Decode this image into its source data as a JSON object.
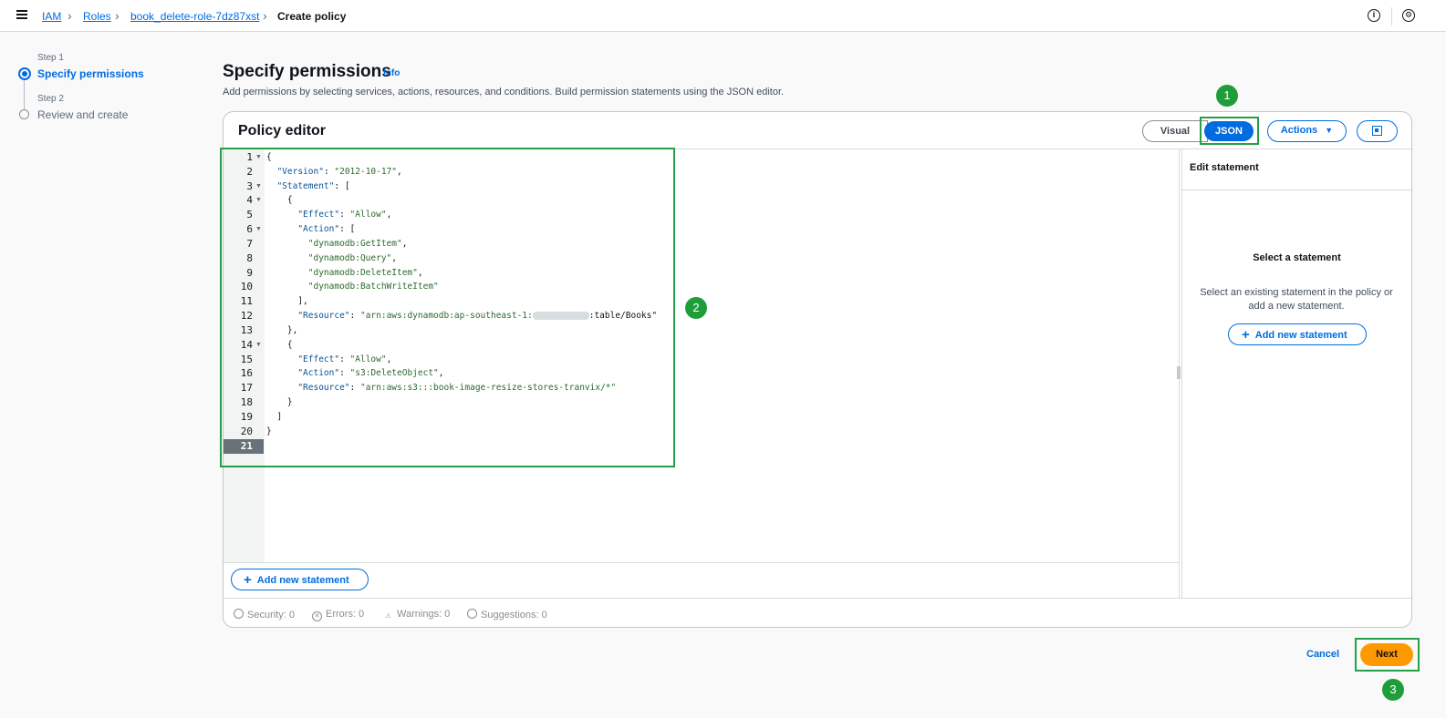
{
  "breadcrumbs": [
    "IAM",
    "Roles",
    "book_delete-role-7dz87xst",
    "Create policy"
  ],
  "steps": [
    {
      "step": "Step 1",
      "label": "Specify permissions"
    },
    {
      "step": "Step 2",
      "label": "Review and create"
    }
  ],
  "header": {
    "title": "Specify permissions",
    "info": "Info",
    "description": "Add permissions by selecting services, actions, resources, and conditions. Build permission statements using the JSON editor."
  },
  "editor": {
    "title": "Policy editor",
    "visual_label": "Visual",
    "json_label": "JSON",
    "actions_label": "Actions",
    "add_statement_label": "Add new statement"
  },
  "code_lines": [
    "{",
    "  \"Version\": \"2012-10-17\",",
    "  \"Statement\": [",
    "    {",
    "      \"Effect\": \"Allow\",",
    "      \"Action\": [",
    "        \"dynamodb:GetItem\",",
    "        \"dynamodb:Query\",",
    "        \"dynamodb:DeleteItem\",",
    "        \"dynamodb:BatchWriteItem\"",
    "      ],",
    "      \"Resource\": \"arn:aws:dynamodb:ap-southeast-1:",
    "    },",
    "    {",
    "      \"Effect\": \"Allow\",",
    "      \"Action\": \"s3:DeleteObject\",",
    "      \"Resource\": \"arn:aws:s3:::book-image-resize-stores-tranvix/*\"",
    "    }",
    "  ]",
    "}",
    ""
  ],
  "resource_suffix": ":table/Books\"",
  "line_numbers": [
    "1",
    "2",
    "3",
    "4",
    "5",
    "6",
    "7",
    "8",
    "9",
    "10",
    "11",
    "12",
    "13",
    "14",
    "15",
    "16",
    "17",
    "18",
    "19",
    "20",
    "21"
  ],
  "side_panel": {
    "title": "Edit statement",
    "select_title": "Select a statement",
    "select_desc": "Select an existing statement in the policy or add a new statement.",
    "add_label": "Add new statement"
  },
  "status": {
    "security": "Security: 0",
    "errors": "Errors: 0",
    "warnings": "Warnings: 0",
    "suggestions": "Suggestions: 0"
  },
  "footer": {
    "cancel": "Cancel",
    "next": "Next"
  },
  "annotations": [
    "1",
    "2",
    "3"
  ],
  "colors": {
    "primary": "#006ce0",
    "next": "#ff9900",
    "annotation": "#24a148"
  }
}
